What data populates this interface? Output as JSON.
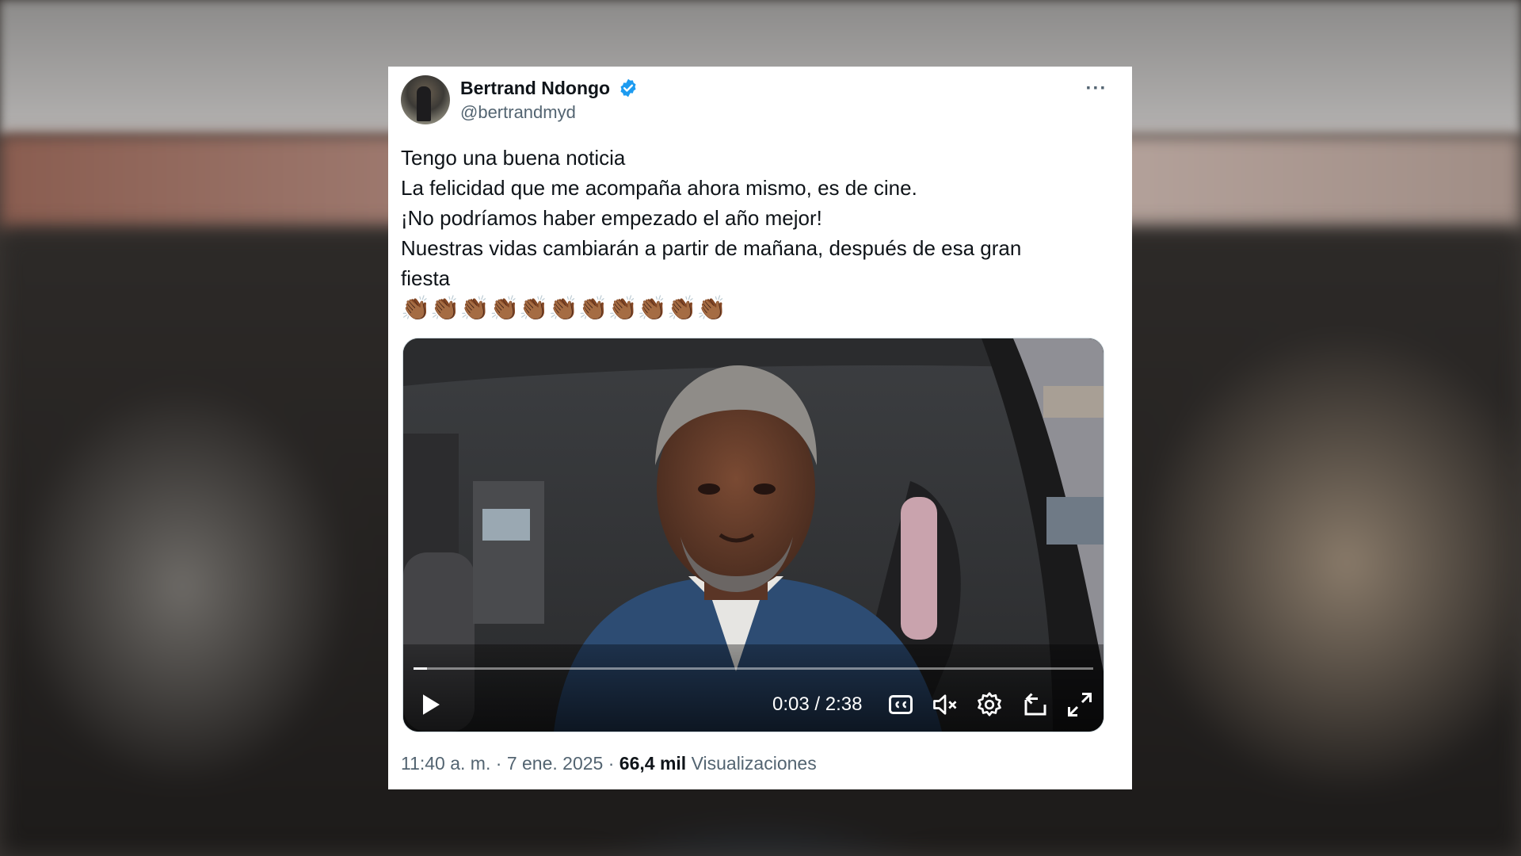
{
  "tweet": {
    "author_name": "Bertrand Ndongo",
    "handle": "@bertrandmyd",
    "lines": [
      "Tengo una buena noticia",
      "La felicidad que me acompaña ahora mismo, es de cine.",
      "¡No podríamos haber empezado el año mejor!",
      "Nuestras vidas cambiarán a partir de mañana, después de esa gran\nfiesta"
    ],
    "emoji_line": "👏🏾👏🏾👏🏾👏🏾👏🏾👏🏾👏🏾👏🏾👏🏾👏🏾👏🏾",
    "more_label": "···",
    "time": "11:40 a. m.",
    "separator": "·",
    "date": "7 ene. 2025",
    "views_count": "66,4 mil",
    "views_label": "Visualizaciones"
  },
  "video": {
    "time_display": "0:03 / 2:38",
    "progress_fraction": 0.02
  },
  "icons": [
    "verified-badge-icon",
    "play-icon",
    "captions-icon",
    "mute-icon",
    "settings-icon",
    "pip-icon",
    "fullscreen-icon",
    "more-icon"
  ],
  "colors": {
    "verified": "#1d9bf0",
    "text": "#0f1419",
    "secondary": "#536471"
  }
}
